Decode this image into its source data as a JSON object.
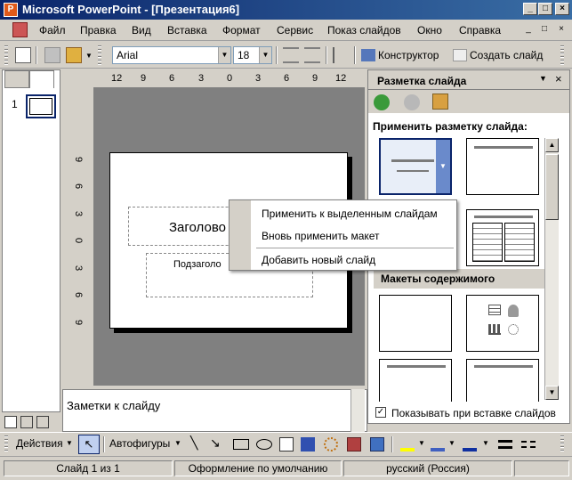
{
  "window": {
    "title": "Microsoft PowerPoint - [Презентация6]"
  },
  "menu": [
    "Файл",
    "Правка",
    "Вид",
    "Вставка",
    "Формат",
    "Сервис",
    "Показ слайдов",
    "Окно",
    "Справка"
  ],
  "toolbar": {
    "font": "Arial",
    "size": "18",
    "designer": "Конструктор",
    "new_slide": "Создать слайд"
  },
  "slides_panel": {
    "slide_number": "1"
  },
  "ruler": {
    "horizontal": [
      "12",
      "9",
      "6",
      "3",
      "0",
      "3",
      "6",
      "9",
      "12"
    ],
    "vertical": [
      "9",
      "6",
      "3",
      "0",
      "3",
      "6",
      "9"
    ]
  },
  "slide": {
    "title_placeholder": "Заголово",
    "subtitle_placeholder": "Подзаголо"
  },
  "notes": {
    "placeholder": "Заметки к слайду"
  },
  "context_menu": {
    "apply_selected": "Применить к выделенным слайдам",
    "reapply": "Вновь применить макет",
    "add_new": "Добавить новый слайд"
  },
  "task_pane": {
    "title": "Разметка слайда",
    "section_apply": "Применить разметку слайда:",
    "section_content": "Макеты содержимого",
    "show_on_insert": "Показывать при вставке слайдов"
  },
  "drawing_toolbar": {
    "actions": "Действия",
    "autoshapes": "Автофигуры"
  },
  "status": {
    "slide": "Слайд 1 из 1",
    "design": "Оформление по умолчанию",
    "language": "русский (Россия)"
  }
}
